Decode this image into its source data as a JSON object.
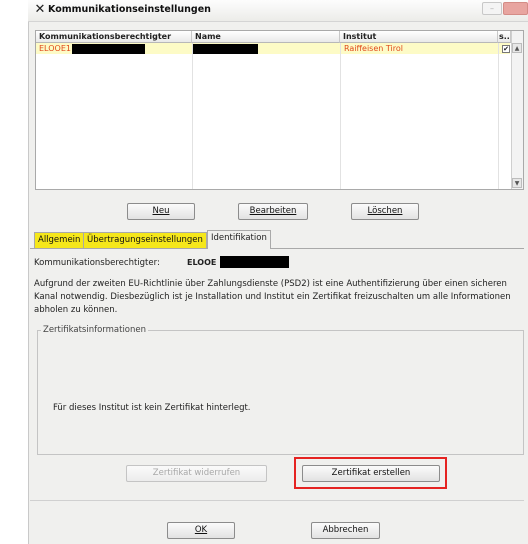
{
  "window": {
    "title": "Kommunikationseinstellungen",
    "close_glyph": "✕",
    "minimize_glyph": "–"
  },
  "table": {
    "columns": [
      "Kommunikationsberechtigter",
      "Name",
      "Institut",
      "s..."
    ],
    "rows": [
      {
        "berechtigter": "ELOOE1",
        "name": "",
        "institut": "Raiffeisen Tirol",
        "checked": "✔"
      }
    ]
  },
  "buttons": {
    "neu": "Neu",
    "bearbeiten": "Bearbeiten",
    "loeschen": "Löschen",
    "widerrufen": "Zertifikat widerrufen",
    "erstellen": "Zertifikat erstellen",
    "ok": "OK",
    "abbrechen": "Abbrechen"
  },
  "tabs": [
    "Allgemein",
    "Übertragungseinstellungen",
    "Identifikation"
  ],
  "identifikation": {
    "berechtigter_label": "Kommunikationsberechtigter:",
    "berechtigter_value": "ELOOE",
    "description": "Aufgrund der zweiten EU-Richtlinie über Zahlungsdienste (PSD2) ist eine Authentifizierung über einen sicheren Kanal notwendig. Diesbezüglich ist je Installation und Institut ein Zertifikat freizuschalten um alle Informationen abholen zu können.",
    "group_title": "Zertifikatsinformationen",
    "no_cert_text": "Für dieses Institut ist kein Zertifikat hinterlegt."
  },
  "colors": {
    "accent_yellow": "#f5e71a",
    "selected_row": "#fdfbc6",
    "row_text": "#e04a1a",
    "highlight_frame": "#e52321"
  }
}
